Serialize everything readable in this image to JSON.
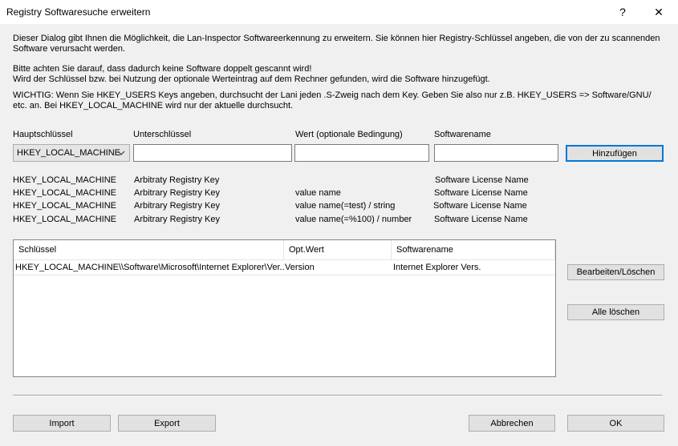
{
  "window": {
    "title": "Registry Softwaresuche erweitern",
    "help": "?",
    "close": "✕"
  },
  "intro": {
    "p1_l1": "Dieser Dialog gibt Ihnen die Möglichkeit, die Lan-Inspector Softwareerkennung zu erweitern. Sie können hier Registry-Schlüssel angeben, die von der zu scannenden",
    "p1_l2": "Software verursacht werden.",
    "p2_l1": "Bitte achten Sie darauf, dass dadurch keine Software doppelt gescannt wird!",
    "p2_l2": "Wird der Schlüssel bzw. bei Nutzung der optionale Werteintrag auf dem Rechner gefunden, wird die Software hinzugefügt.",
    "p3_l1": "WICHTIG: Wenn Sie HKEY_USERS Keys angeben, durchsucht der Lani jeden .S-Zweig nach dem Key. Geben Sie also nur z.B. HKEY_USERS  =>  Software/GNU/",
    "p3_l2": "etc. an. Bei HKEY_LOCAL_MACHINE wird nur der aktuelle durchsucht."
  },
  "form": {
    "label_main": "Hauptschlüssel",
    "label_sub": "Unterschlüssel",
    "label_value": "Wert (optionale Bedingung)",
    "label_name": "Softwarename",
    "main_selected": "HKEY_LOCAL_MACHINE",
    "sub_value": "",
    "value_value": "",
    "name_value": "",
    "add_button": "Hinzufügen"
  },
  "examples": [
    {
      "main": "HKEY_LOCAL_MACHINE",
      "sub": "Arbitraty Registry Key",
      "value": "",
      "name": "Software License Name"
    },
    {
      "main": "HKEY_LOCAL_MACHINE",
      "sub": "Arbitrary Registry Key",
      "value": "value name",
      "name": "Software License Name"
    },
    {
      "main": "HKEY_LOCAL_MACHINE",
      "sub": "Arbitrary Registry Key",
      "value": "value name(=test)  / string",
      "name": "Software License Name"
    },
    {
      "main": "HKEY_LOCAL_MACHINE",
      "sub": "Arbitrary Registry Key",
      "value": "value name(=%100)  / number",
      "name": "Software License Name"
    }
  ],
  "list": {
    "col_key": "Schlüssel",
    "col_value": "Opt.Wert",
    "col_name": "Softwarename",
    "rows": [
      {
        "key": "HKEY_LOCAL_MACHINE\\\\Software\\Microsoft\\Internet Explorer\\Ver...",
        "value": "Version",
        "name": "Internet Explorer Vers."
      }
    ]
  },
  "side_buttons": {
    "edit_delete": "Bearbeiten/Löschen",
    "delete_all": "Alle löschen"
  },
  "footer": {
    "import": "Import",
    "export": "Export",
    "cancel": "Abbrechen",
    "ok": "OK"
  }
}
